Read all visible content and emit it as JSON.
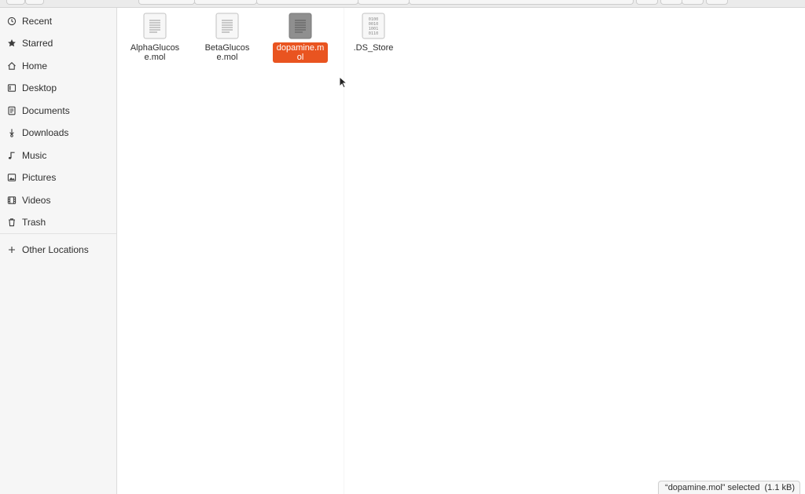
{
  "sidebar": {
    "items": [
      {
        "label": "Recent",
        "icon": "clock-icon"
      },
      {
        "label": "Starred",
        "icon": "star-icon"
      },
      {
        "label": "Home",
        "icon": "home-icon"
      },
      {
        "label": "Desktop",
        "icon": "desktop-icon"
      },
      {
        "label": "Documents",
        "icon": "document-icon"
      },
      {
        "label": "Downloads",
        "icon": "download-icon"
      },
      {
        "label": "Music",
        "icon": "music-icon"
      },
      {
        "label": "Pictures",
        "icon": "picture-icon"
      },
      {
        "label": "Videos",
        "icon": "video-icon"
      },
      {
        "label": "Trash",
        "icon": "trash-icon"
      }
    ],
    "other_locations": {
      "label": "Other Locations",
      "icon": "plus-icon"
    }
  },
  "files": [
    {
      "name": "AlphaGlucose.mol",
      "icon": "text-file-icon",
      "selected": false
    },
    {
      "name": "BetaGlucose.mol",
      "icon": "text-file-icon",
      "selected": false
    },
    {
      "name": "dopamine.mol",
      "icon": "text-file-icon",
      "selected": true
    },
    {
      "name": ".DS_Store",
      "icon": "binary-file-icon",
      "selected": false
    }
  ],
  "status": {
    "selection": "“dopamine.mol” selected",
    "size": "(1.1 kB)"
  },
  "colors": {
    "accent": "#e95420",
    "sidebar_bg": "#f6f6f6"
  }
}
